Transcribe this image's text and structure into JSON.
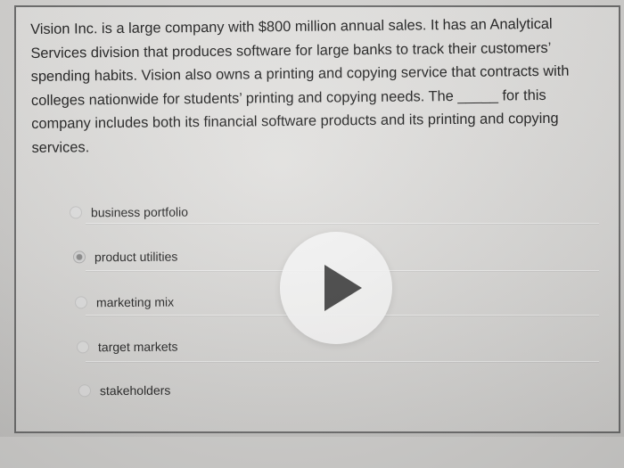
{
  "question": {
    "text": "Vision Inc. is a large company with $800 million annual sales. It has an Analytical Services division that produces software for large banks to track their customers’ spending habits. Vision also owns a printing and copying service that contracts with colleges nationwide for students’ printing and copying needs. The _____ for this company includes both its financial software products and its printing and copying services."
  },
  "options": [
    {
      "label": "business portfolio",
      "selected": false
    },
    {
      "label": "product utilities",
      "selected": true
    },
    {
      "label": "marketing mix",
      "selected": false
    },
    {
      "label": "target markets",
      "selected": false
    },
    {
      "label": "stakeholders",
      "selected": false
    }
  ],
  "video_overlay": {
    "icon": "play-icon"
  }
}
